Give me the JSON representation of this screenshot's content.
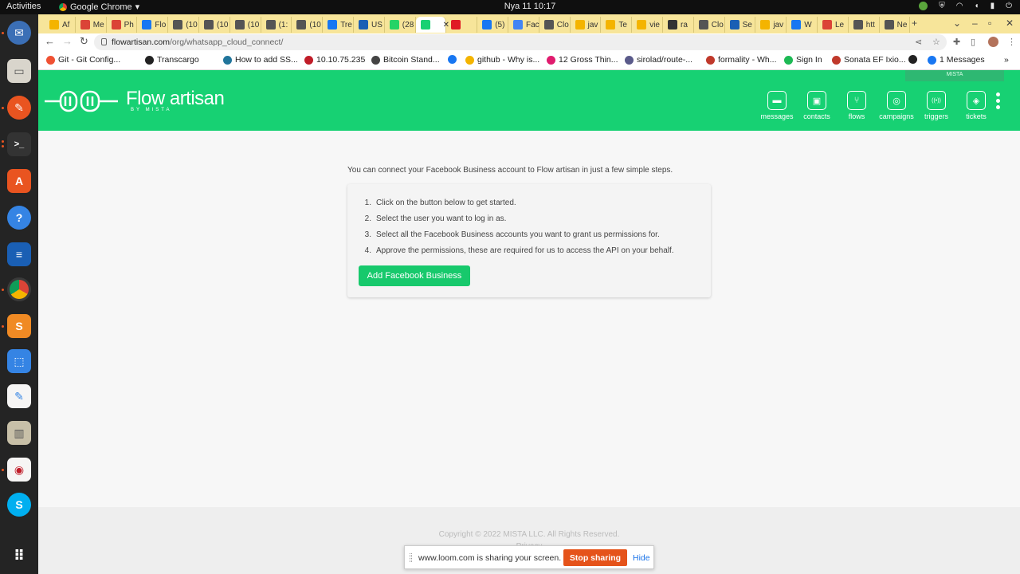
{
  "system": {
    "activities": "Activities",
    "app_name": "Google Chrome",
    "clock": "Nya 11  10:17"
  },
  "browser": {
    "tabs": [
      {
        "label": "Af",
        "color": "#f4b400"
      },
      {
        "label": "Me",
        "color": "#db4437"
      },
      {
        "label": "Ph",
        "color": "#db4437"
      },
      {
        "label": "Flo",
        "color": "#1877f2"
      },
      {
        "label": "(10",
        "color": "#555555"
      },
      {
        "label": "(10",
        "color": "#555555"
      },
      {
        "label": "(10",
        "color": "#555555"
      },
      {
        "label": "(1:",
        "color": "#555555"
      },
      {
        "label": "(10",
        "color": "#555555"
      },
      {
        "label": "Tre",
        "color": "#1877f2"
      },
      {
        "label": "US",
        "color": "#1a5fb4"
      },
      {
        "label": "(28",
        "color": "#25d366"
      },
      {
        "label": "",
        "color": "#17d173"
      },
      {
        "label": "",
        "color": "#e01b24"
      },
      {
        "label": "(5)",
        "color": "#1877f2"
      },
      {
        "label": "Fac",
        "color": "#4285f4"
      },
      {
        "label": "Clo",
        "color": "#555555"
      },
      {
        "label": "jav",
        "color": "#f4b400"
      },
      {
        "label": "Te",
        "color": "#f4b400"
      },
      {
        "label": "vie",
        "color": "#f4b400"
      },
      {
        "label": "ra",
        "color": "#333333"
      },
      {
        "label": "Clo",
        "color": "#555555"
      },
      {
        "label": "Se",
        "color": "#1a5fb4"
      },
      {
        "label": "jav",
        "color": "#f4b400"
      },
      {
        "label": "W",
        "color": "#1877f2"
      },
      {
        "label": "Le",
        "color": "#db4437"
      },
      {
        "label": "htt",
        "color": "#555555"
      },
      {
        "label": "Ne",
        "color": "#555555"
      }
    ],
    "url_host": "flowartisan.com",
    "url_path": "/org/whatsapp_cloud_connect/",
    "bookmarks": [
      {
        "label": "Git - Git Config...",
        "color": "#f05133"
      },
      {
        "label": "Transcargo",
        "color": "#222222"
      },
      {
        "label": "How to add SS...",
        "color": "#21759b"
      },
      {
        "label": "10.10.75.235",
        "color": "#c01c28"
      },
      {
        "label": "Bitcoin Stand...",
        "color": "#444444"
      },
      {
        "label": "",
        "color": "#1877f2"
      },
      {
        "label": "github - Why is...",
        "color": "#f4b400"
      },
      {
        "label": "12 Gross Thin...",
        "color": "#e01b6e"
      },
      {
        "label": "sirolad/route-...",
        "color": "#5a5a8a"
      },
      {
        "label": "formality - Wh...",
        "color": "#c0392b"
      },
      {
        "label": "Sign In",
        "color": "#1db954"
      },
      {
        "label": "Sonata EF Ixio...",
        "color": "#c0392b"
      },
      {
        "label": "",
        "color": "#222222"
      },
      {
        "label": "1 Messages",
        "color": "#1877f2"
      }
    ]
  },
  "app": {
    "brand": "Flow artisan",
    "brand_sub": "BY MISTA",
    "tooltip": "MISTA",
    "nav": [
      {
        "label": "messages",
        "icon": "chat-bubble"
      },
      {
        "label": "contacts",
        "icon": "contact-card"
      },
      {
        "label": "flows",
        "icon": "flow-tree"
      },
      {
        "label": "campaigns",
        "icon": "target"
      },
      {
        "label": "triggers",
        "icon": "broadcast"
      },
      {
        "label": "tickets",
        "icon": "ticket"
      }
    ],
    "accent": "#17d173"
  },
  "main": {
    "intro": "You can connect your Facebook Business account to Flow artisan in just a few simple steps.",
    "steps": [
      {
        "num": "1.",
        "text": "Click on the button below to get started."
      },
      {
        "num": "2.",
        "text": "Select the user you want to log in as."
      },
      {
        "num": "3.",
        "text": "Select all the Facebook Business accounts you want to grant us permissions for."
      },
      {
        "num": "4.",
        "text": "Approve the permissions, these are required for us to access the API on your behalf."
      }
    ],
    "button_label": "Add Facebook Business"
  },
  "footer": {
    "copyright": "Copyright © 2022 MISTA LLC. All Rights Reserved.",
    "privacy": "Privacy"
  },
  "loom": {
    "message": "www.loom.com is sharing your screen.",
    "stop_label": "Stop sharing",
    "hide_label": "Hide"
  }
}
